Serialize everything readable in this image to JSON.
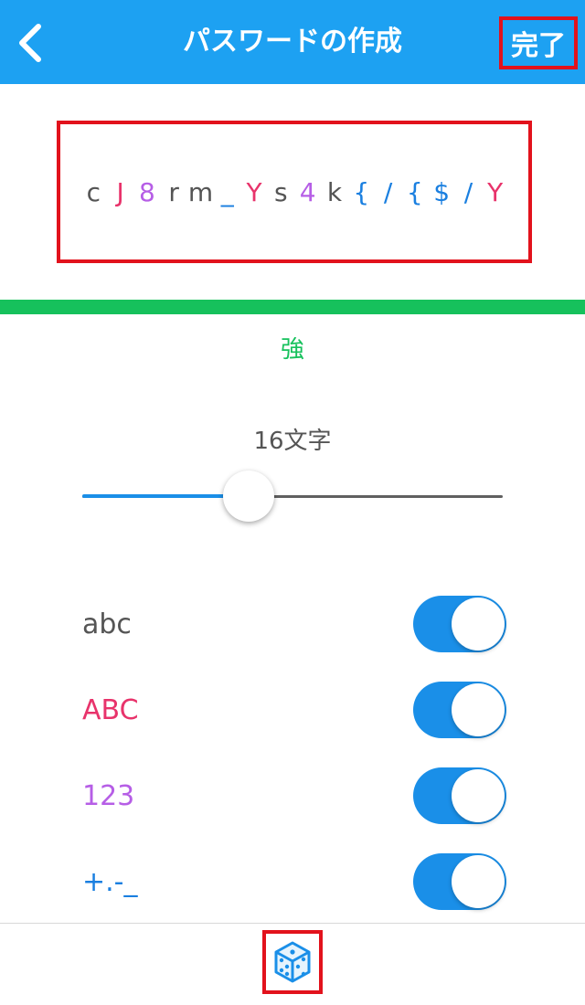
{
  "header": {
    "title": "パスワードの作成",
    "done_label": "完了",
    "back_icon": "chevron-left-icon"
  },
  "password": {
    "chars": [
      {
        "c": "c",
        "color": "#555555"
      },
      {
        "c": "J",
        "color": "#e8336b"
      },
      {
        "c": "8",
        "color": "#b65ee6"
      },
      {
        "c": "r",
        "color": "#555555"
      },
      {
        "c": "m",
        "color": "#555555"
      },
      {
        "c": "_",
        "color": "#1a7fe0"
      },
      {
        "c": "Y",
        "color": "#e8336b"
      },
      {
        "c": "s",
        "color": "#555555"
      },
      {
        "c": "4",
        "color": "#b65ee6"
      },
      {
        "c": "k",
        "color": "#555555"
      },
      {
        "c": "{",
        "color": "#1a7fe0"
      },
      {
        "c": "/",
        "color": "#1a7fe0"
      },
      {
        "c": "{",
        "color": "#1a7fe0"
      },
      {
        "c": "$",
        "color": "#1a7fe0"
      },
      {
        "c": "/",
        "color": "#1a7fe0"
      },
      {
        "c": "Y",
        "color": "#e8336b"
      }
    ]
  },
  "strength": {
    "label": "強",
    "color": "#16c15c"
  },
  "length": {
    "label": "16文字",
    "slider_fraction": 0.395
  },
  "options": [
    {
      "label": "abc",
      "color": "#555555",
      "on": true
    },
    {
      "label": "ABC",
      "color": "#e8336b",
      "on": true
    },
    {
      "label": "123",
      "color": "#b65ee6",
      "on": true
    },
    {
      "label": "+.-_",
      "color": "#1a7fe0",
      "on": true
    }
  ],
  "footer": {
    "dice_icon": "dice-icon"
  },
  "colors": {
    "accent": "#1da1f2",
    "toggle_on": "#1a8fe8",
    "highlight_border": "#e2121c"
  }
}
